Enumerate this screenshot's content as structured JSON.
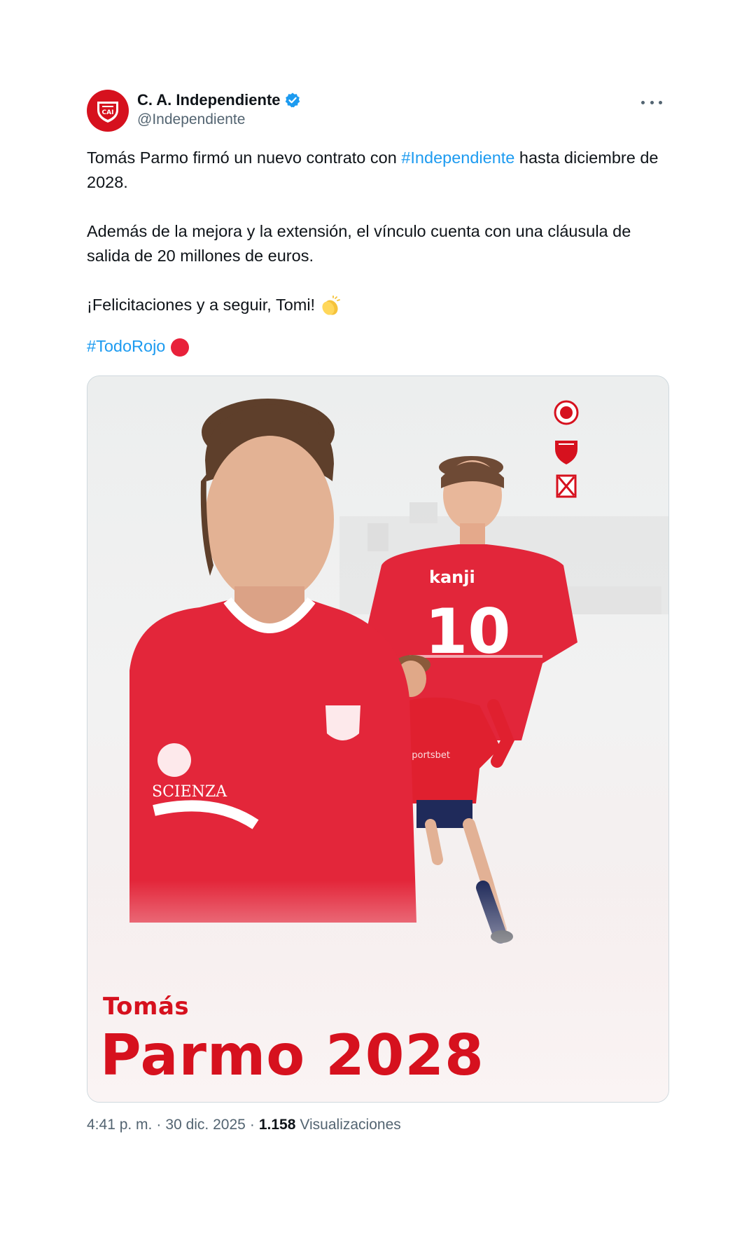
{
  "tweet": {
    "author": {
      "display_name": "C. A. Independiente",
      "handle": "@Independiente",
      "verified": true,
      "avatar_icon": "independiente-crest-icon"
    },
    "text": {
      "p1_before": "Tomás Parmo firmó un nuevo contrato con ",
      "p1_hashtag": "#Independiente",
      "p1_after": " hasta diciembre de 2028.",
      "p2": "Además de la mejora y la extensión, el vínculo cuenta con una cláusula de salida de 20 millones de euros.",
      "p3": "¡Felicitaciones y a seguir, Tomi! ",
      "p3_emoji": "clapping-hands-icon",
      "p4_hashtag": "#TodoRojo",
      "p4_emoji": "red-circle-icon"
    },
    "media": {
      "poster_first_name": "Tomás",
      "poster_last_name": "Parmo 2028",
      "jersey_sponsor": "Kanji",
      "jersey_number": "10",
      "side_icons": [
        "club-badge-icon",
        "shield-crest-icon",
        "flag-crest-icon"
      ]
    },
    "meta": {
      "time": "4:41 p. m.",
      "separator": "·",
      "date": "30 dic. 2025",
      "views_count": "1.158",
      "views_label": "Visualizaciones"
    }
  },
  "colors": {
    "brand_red": "#d6111e",
    "link_blue": "#1d9bf0",
    "text_primary": "#0f1419",
    "text_secondary": "#536471",
    "verified_blue": "#1d9bf0"
  }
}
